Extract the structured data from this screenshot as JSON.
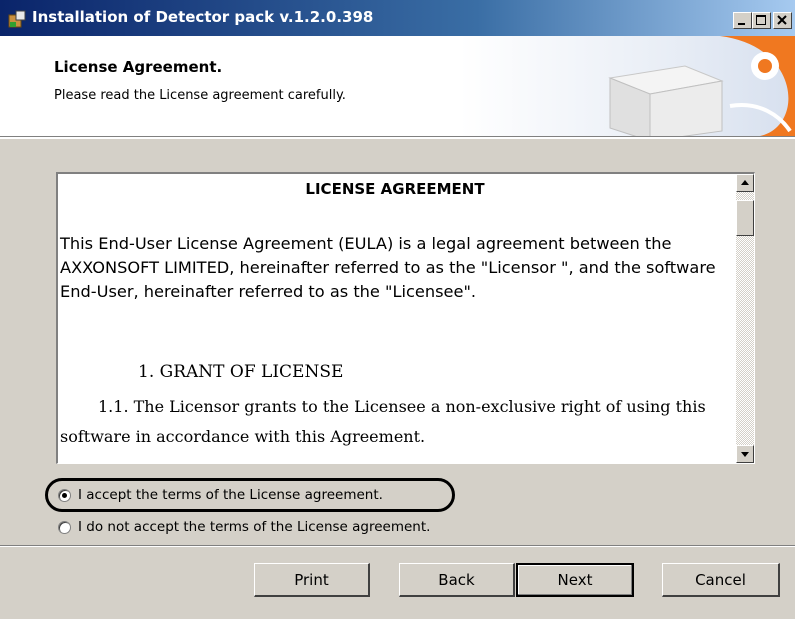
{
  "window": {
    "title": "Installation of Detector pack v.1.2.0.398",
    "controls": [
      "minimize-icon",
      "maximize-icon",
      "close-icon"
    ]
  },
  "header": {
    "title": "License Agreement.",
    "subtitle": "Please read the License agreement carefully."
  },
  "license": {
    "heading": "LICENSE AGREEMENT",
    "paragraph": "This End-User License Agreement (EULA) is a legal agreement between the AXXONSOFT LIMITED, hereinafter referred to as the \"Licensor \", and the software End-User, hereinafter referred to as the \"Licensee\".",
    "grant_heading": "1. GRANT OF LICENSE",
    "clause_1_1": "1.1. The Licensor grants to the Licensee a non-exclusive right of using this software in accordance with this Agreement."
  },
  "options": {
    "accept_label": "I accept the terms of the License agreement.",
    "decline_label": "I do not accept the terms of the License agreement.",
    "selected": "accept"
  },
  "buttons": {
    "print": "Print",
    "back": "Back",
    "next": "Next",
    "cancel": "Cancel"
  },
  "colors": {
    "titlebar_start": "#0a246a",
    "titlebar_end": "#a6caf0",
    "dialog_bg": "#d4d0c8",
    "header_accent": "#f07820"
  }
}
